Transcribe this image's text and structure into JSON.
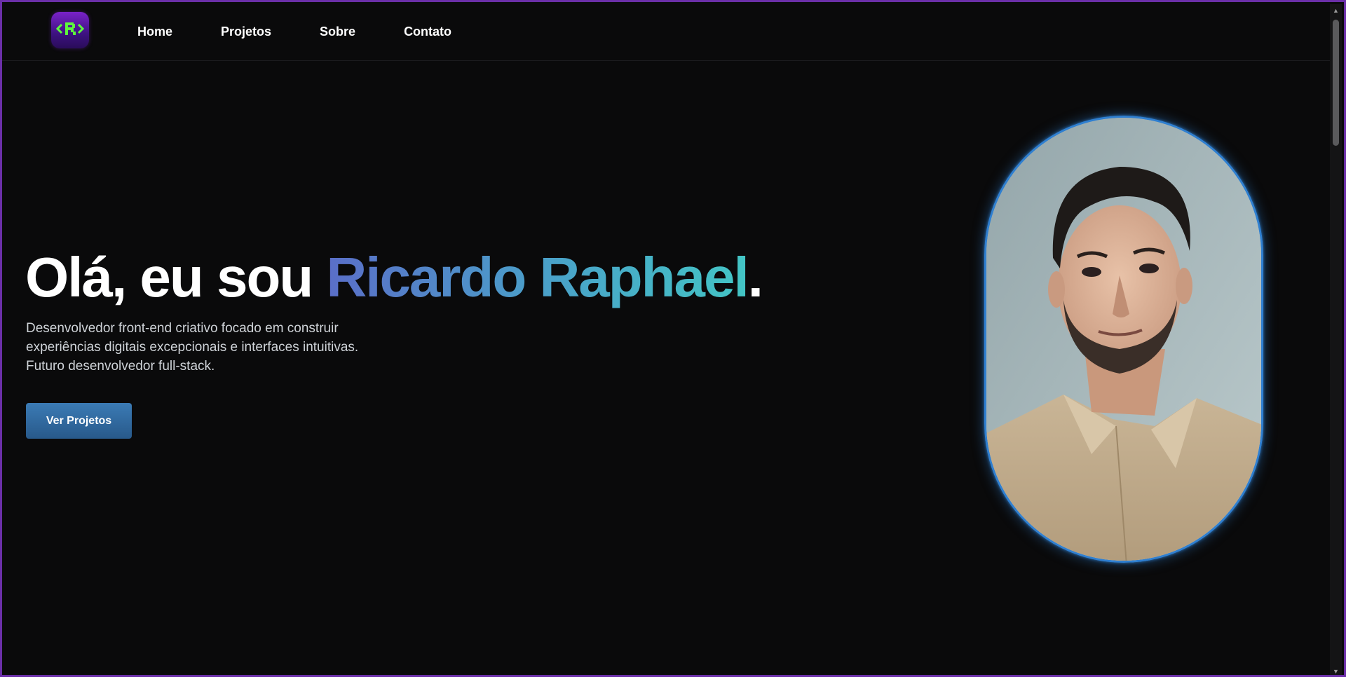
{
  "nav": {
    "logo_icon": "code-bracket-r-icon",
    "links": [
      "Home",
      "Projetos",
      "Sobre",
      "Contato"
    ]
  },
  "hero": {
    "title_prefix": "Olá, eu sou ",
    "title_name": "Ricardo Raphael",
    "title_suffix": ".",
    "description_lines": [
      "Desenvolvedor front-end criativo focado em construir",
      "experiências digitais excepcionais e interfaces intuitivas.",
      "Futuro desenvolvedor full-stack."
    ],
    "cta_label": "Ver Projetos"
  },
  "colors": {
    "background": "#0a0a0b",
    "frame_border": "#6b2fa8",
    "accent_blue": "#2f7fd0",
    "name_gradient_start": "#5a6ec8",
    "name_gradient_end": "#43c5c5",
    "button": "#3b7bb5",
    "logo_purple": "#7a22c9",
    "logo_green": "#5dfa3c"
  },
  "icons": {
    "scroll_up": "▲",
    "scroll_down": "▼"
  }
}
